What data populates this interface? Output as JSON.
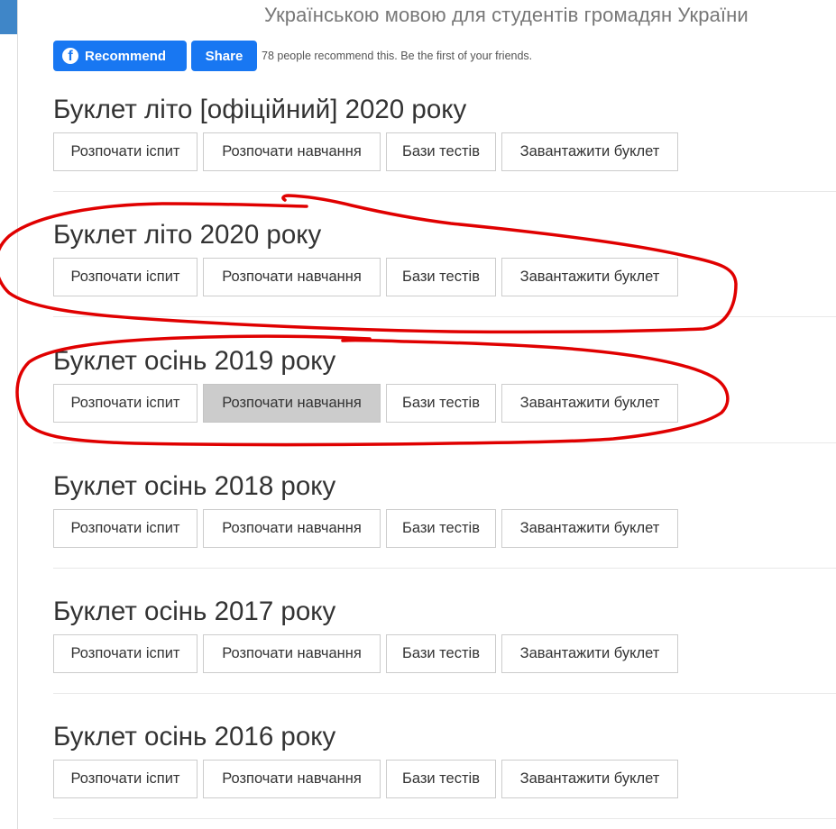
{
  "header": {
    "subtitle": "Українською мовою для студентів громадян України"
  },
  "facebook": {
    "recommend_label": "Recommend",
    "share_label": "Share",
    "social_text": "78 people recommend this. Be the first of your friends.",
    "brand_color": "#1877f2"
  },
  "booklets": [
    {
      "title": "Буклет літо [офіційний] 2020 року"
    },
    {
      "title": "Буклет літо 2020 року"
    },
    {
      "title": "Буклет осінь 2019 року"
    },
    {
      "title": "Буклет осінь 2018 року"
    },
    {
      "title": "Буклет осінь 2017 року"
    },
    {
      "title": "Буклет осінь 2016 року"
    }
  ],
  "buttons": {
    "start_exam": "Розпочати іспит",
    "start_learning": "Розпочати навчання",
    "test_bases": "Бази тестів",
    "download_booklet": "Завантажити буклет"
  },
  "annotation_color": "#e00000"
}
